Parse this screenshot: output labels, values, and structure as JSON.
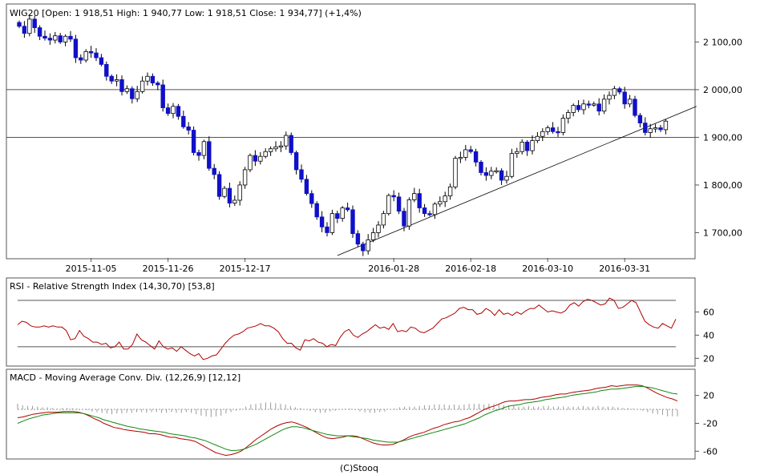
{
  "header": {
    "price_title": "WIG20 [Open: 1 918,51  High: 1 940,77  Low: 1 918,51  Close: 1 934,77] (+1,4%)",
    "rsi_title": "RSI - Relative Strength Index (14,30,70) [53,8]",
    "macd_title": "MACD - Moving Average Conv. Div. (12,26,9) [12,12]",
    "footer": "(C)Stooq"
  },
  "colors": {
    "candle_up": "#ffffff",
    "candle_down": "#1010c8",
    "rsi": "#b00000",
    "macd": "#b00000",
    "signal": "#118811",
    "hist": "#9a9a9a",
    "trend": "#000000"
  },
  "chart_data": [
    {
      "type": "candlestick",
      "title": "WIG20",
      "x_tick_labels": [
        "2015-11-05",
        "2015-11-26",
        "2015-12-17",
        "2016-01-28",
        "2016-02-18",
        "2016-03-10",
        "2016-03-31"
      ],
      "x_tick_index": [
        14,
        29,
        44,
        73,
        88,
        103,
        118
      ],
      "y_tick_labels": [
        "2 100,00",
        "2 000,00",
        "1 900,00",
        "1 800,00",
        "1 700,00"
      ],
      "y_ticks": [
        2100,
        2000,
        1900,
        1800,
        1700
      ],
      "ylim": [
        1647,
        2178
      ],
      "h_lines": [
        2000,
        1900
      ],
      "trendline": {
        "from": {
          "i": 62,
          "v": 1652
        },
        "to": {
          "i": 132,
          "v": 1965
        }
      },
      "close": [
        2133,
        2118,
        2148,
        2130,
        2112,
        2108,
        2104,
        2113,
        2100,
        2112,
        2106,
        2067,
        2062,
        2080,
        2077,
        2067,
        2053,
        2028,
        2018,
        2021,
        1996,
        2002,
        1981,
        1996,
        2018,
        2028,
        2014,
        2010,
        1962,
        1950,
        1965,
        1944,
        1922,
        1915,
        1868,
        1862,
        1891,
        1835,
        1822,
        1776,
        1793,
        1762,
        1768,
        1800,
        1832,
        1862,
        1850,
        1860,
        1870,
        1876,
        1880,
        1882,
        1904,
        1868,
        1832,
        1812,
        1782,
        1761,
        1733,
        1712,
        1700,
        1740,
        1730,
        1752,
        1748,
        1698,
        1676,
        1662,
        1685,
        1700,
        1716,
        1740,
        1778,
        1775,
        1745,
        1714,
        1769,
        1782,
        1752,
        1740,
        1738,
        1760,
        1765,
        1777,
        1796,
        1856,
        1858,
        1874,
        1870,
        1848,
        1826,
        1820,
        1829,
        1830,
        1810,
        1818,
        1866,
        1870,
        1890,
        1872,
        1893,
        1902,
        1912,
        1920,
        1912,
        1910,
        1940,
        1952,
        1967,
        1958,
        1970,
        1968,
        1970,
        1955,
        1980,
        1988,
        2002,
        1995,
        1970,
        1980,
        1946,
        1930,
        1910,
        1918,
        1920,
        1916,
        1934
      ],
      "ohlc_note": "bars derived from close; open = previous close"
    },
    {
      "type": "line",
      "title": "RSI",
      "series": [
        {
          "name": "RSI",
          "values": [
            49,
            52,
            51,
            48,
            47,
            47,
            48,
            47,
            48,
            47,
            47,
            44,
            36,
            37,
            44,
            39,
            37,
            34,
            34,
            32,
            33,
            29,
            30,
            34,
            28,
            28,
            32,
            41,
            36,
            34,
            31,
            28,
            35,
            30,
            28,
            29,
            26,
            30,
            27,
            24,
            22,
            24,
            19,
            20,
            22,
            23,
            28,
            33,
            37,
            40,
            41,
            43,
            46,
            47,
            48,
            50,
            48,
            48,
            46,
            43,
            37,
            33,
            33,
            29,
            27,
            36,
            35,
            37,
            34,
            33,
            30,
            32,
            31,
            38,
            43,
            45,
            40,
            38,
            41,
            43,
            46,
            49,
            46,
            47,
            45,
            50,
            43,
            44,
            43,
            47,
            46,
            43,
            42,
            44,
            46,
            50,
            54,
            55,
            57,
            59,
            63,
            64,
            62,
            62,
            58,
            59,
            63,
            61,
            57,
            62,
            58,
            59,
            57,
            60,
            58,
            61,
            63,
            63,
            66,
            63,
            60,
            61,
            60,
            59,
            61,
            66,
            68,
            65,
            69,
            71,
            70,
            68,
            66,
            67,
            72,
            70,
            63,
            64,
            67,
            70,
            68,
            60,
            52,
            49,
            47,
            46,
            50,
            48,
            46,
            53.8
          ]
        }
      ],
      "y_tick_labels": [
        "60",
        "40",
        "20"
      ],
      "y_ticks": [
        60,
        40,
        20
      ],
      "h_lines": [
        70,
        30
      ],
      "ylim": [
        14,
        79
      ]
    },
    {
      "type": "line",
      "title": "MACD",
      "series": [
        {
          "name": "MACD",
          "values": [
            -12,
            -11,
            -9,
            -7,
            -6,
            -5,
            -4,
            -4,
            -4,
            -3,
            -3,
            -3,
            -4,
            -6,
            -9,
            -13,
            -16,
            -20,
            -23,
            -26,
            -27,
            -29,
            -30,
            -31,
            -32,
            -33,
            -35,
            -35,
            -36,
            -38,
            -40,
            -40,
            -42,
            -43,
            -44,
            -46,
            -50,
            -54,
            -58,
            -62,
            -64,
            -66,
            -65,
            -63,
            -60,
            -55,
            -49,
            -43,
            -38,
            -33,
            -28,
            -24,
            -21,
            -19,
            -18,
            -20,
            -23,
            -26,
            -30,
            -34,
            -38,
            -41,
            -42,
            -41,
            -40,
            -38,
            -38,
            -39,
            -42,
            -45,
            -48,
            -50,
            -51,
            -51,
            -50,
            -47,
            -44,
            -40,
            -37,
            -35,
            -33,
            -30,
            -27,
            -25,
            -22,
            -20,
            -18,
            -17,
            -14,
            -12,
            -8,
            -4,
            0,
            3,
            5,
            8,
            11,
            12,
            12,
            13,
            14,
            14,
            15,
            17,
            18,
            19,
            21,
            22,
            22,
            24,
            25,
            26,
            27,
            28,
            30,
            31,
            32,
            34,
            33,
            34,
            35,
            35,
            35,
            34,
            31,
            27,
            23,
            20,
            17,
            15,
            12
          ]
        },
        {
          "name": "Signal",
          "values": [
            -20,
            -17,
            -14,
            -12,
            -10,
            -8,
            -7,
            -6,
            -5,
            -5,
            -5,
            -5,
            -5,
            -6,
            -8,
            -10,
            -12,
            -15,
            -17,
            -19,
            -21,
            -23,
            -25,
            -26,
            -28,
            -29,
            -30,
            -31,
            -32,
            -33,
            -35,
            -36,
            -37,
            -38,
            -40,
            -41,
            -43,
            -45,
            -48,
            -51,
            -54,
            -57,
            -59,
            -59,
            -58,
            -56,
            -53,
            -50,
            -46,
            -42,
            -38,
            -34,
            -30,
            -27,
            -25,
            -25,
            -26,
            -28,
            -30,
            -32,
            -34,
            -36,
            -37,
            -38,
            -38,
            -38,
            -39,
            -40,
            -41,
            -42,
            -44,
            -45,
            -46,
            -47,
            -47,
            -47,
            -45,
            -43,
            -41,
            -39,
            -37,
            -35,
            -33,
            -31,
            -29,
            -27,
            -25,
            -23,
            -21,
            -18,
            -15,
            -12,
            -8,
            -5,
            -2,
            0,
            3,
            5,
            6,
            7,
            9,
            10,
            11,
            12,
            14,
            15,
            16,
            17,
            18,
            20,
            21,
            22,
            23,
            24,
            25,
            27,
            28,
            29,
            29,
            30,
            31,
            32,
            33,
            33,
            32,
            31,
            29,
            27,
            25,
            23,
            22
          ]
        }
      ],
      "histogram": [
        8,
        6,
        5,
        5,
        4,
        3,
        3,
        2,
        1,
        2,
        2,
        2,
        1,
        0,
        -1,
        -3,
        -4,
        -5,
        -6,
        -7,
        -6,
        -6,
        -5,
        -5,
        -4,
        -4,
        -5,
        -4,
        -4,
        -5,
        -5,
        -4,
        -5,
        -5,
        -4,
        -5,
        -7,
        -9,
        -10,
        -11,
        -10,
        -9,
        -6,
        -4,
        -2,
        1,
        4,
        7,
        8,
        9,
        10,
        10,
        9,
        8,
        7,
        5,
        3,
        2,
        0,
        -2,
        -4,
        -5,
        -5,
        -3,
        -2,
        0,
        1,
        1,
        -1,
        -3,
        -4,
        -5,
        -5,
        -4,
        -3,
        0,
        1,
        3,
        4,
        4,
        4,
        5,
        6,
        6,
        7,
        7,
        7,
        6,
        7,
        6,
        7,
        8,
        8,
        8,
        7,
        8,
        8,
        7,
        6,
        6,
        5,
        4,
        4,
        5,
        4,
        4,
        5,
        5,
        4,
        4,
        4,
        4,
        4,
        4,
        5,
        4,
        4,
        5,
        4,
        4,
        4,
        3,
        2,
        2,
        1,
        0,
        -2,
        -4,
        -6,
        -7,
        -8,
        -10,
        -10,
        -10
      ],
      "y_tick_labels": [
        "20",
        "-20",
        "-60"
      ],
      "y_ticks": [
        20,
        -20,
        -60
      ],
      "h_lines": [
        0
      ],
      "ylim": [
        -70,
        38
      ]
    }
  ]
}
